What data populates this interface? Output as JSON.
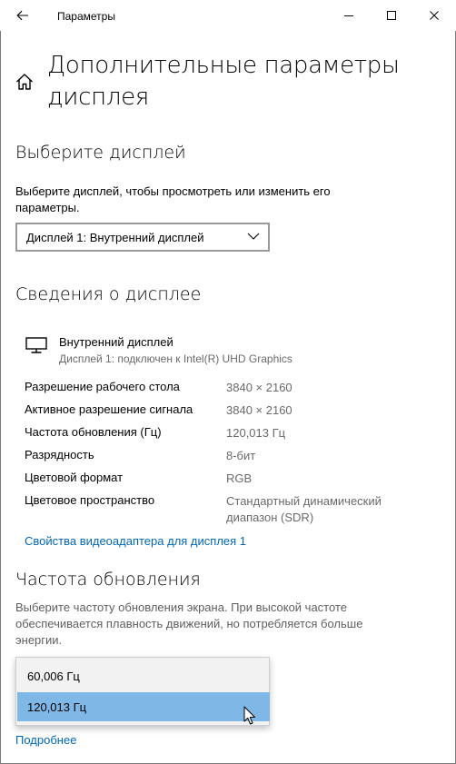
{
  "titlebar": {
    "title": "Параметры",
    "back_icon": "arrow-left",
    "minimize_icon": "minimize",
    "maximize_icon": "maximize",
    "close_icon": "close"
  },
  "page": {
    "home_icon": "home",
    "title": "Дополнительные параметры дисплея"
  },
  "select_display": {
    "heading": "Выберите дисплей",
    "description": "Выберите дисплей, чтобы просмотреть или изменить его параметры.",
    "dropdown_value": "Дисплей 1: Внутренний дисплей"
  },
  "display_info": {
    "heading": "Сведения о дисплее",
    "monitor_icon": "monitor",
    "display_name": "Внутренний дисплей",
    "display_sub": "Дисплей 1: подключен к Intel(R) UHD Graphics",
    "rows": [
      {
        "label": "Разрешение рабочего стола",
        "value": "3840 × 2160"
      },
      {
        "label": "Активное разрешение сигнала",
        "value": "3840 × 2160"
      },
      {
        "label": "Частота обновления (Гц)",
        "value": "120,013 Гц"
      },
      {
        "label": "Разрядность",
        "value": "8-бит"
      },
      {
        "label": "Цветовой формат",
        "value": "RGB"
      },
      {
        "label": "Цветовое пространство",
        "value": "Стандартный динамический диапазон (SDR)"
      }
    ],
    "adapter_link": "Свойства видеоадаптера для дисплея 1"
  },
  "refresh_rate": {
    "heading": "Частота обновления",
    "description": "Выберите частоту обновления экрана. При высокой частоте обеспечивается плавность движений, но потребляется больше энергии.",
    "options": [
      "60,006 Гц",
      "120,013 Гц"
    ],
    "selected": "120,013 Гц",
    "more_link": "Подробнее"
  },
  "colors": {
    "link": "#0067b8",
    "selected_option": "#7fb8e6",
    "secondary_text": "#6a6a6a"
  }
}
